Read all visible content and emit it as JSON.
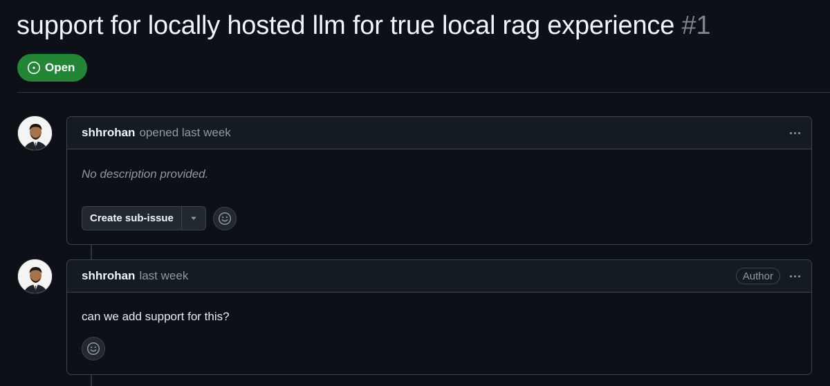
{
  "issue": {
    "title": "support for locally hosted llm for true local rag experience",
    "number": "#1",
    "state": "Open"
  },
  "comments": [
    {
      "author": "shhrohan",
      "meta": "opened last week",
      "body": "No description provided.",
      "sub_issue_button": "Create sub-issue"
    },
    {
      "author": "shhrohan",
      "meta": "last week",
      "role_badge": "Author",
      "body": "can we add support for this?"
    }
  ],
  "icons": {
    "state": "issue-opened-icon",
    "menu": "kebab-horizontal-icon",
    "caret": "triangle-down-icon",
    "reaction": "smiley-icon",
    "avatar": "user-avatar"
  },
  "colors": {
    "background": "#0d1117",
    "open_green": "#238636",
    "border": "#3d444d",
    "muted_text": "#9198a1"
  }
}
